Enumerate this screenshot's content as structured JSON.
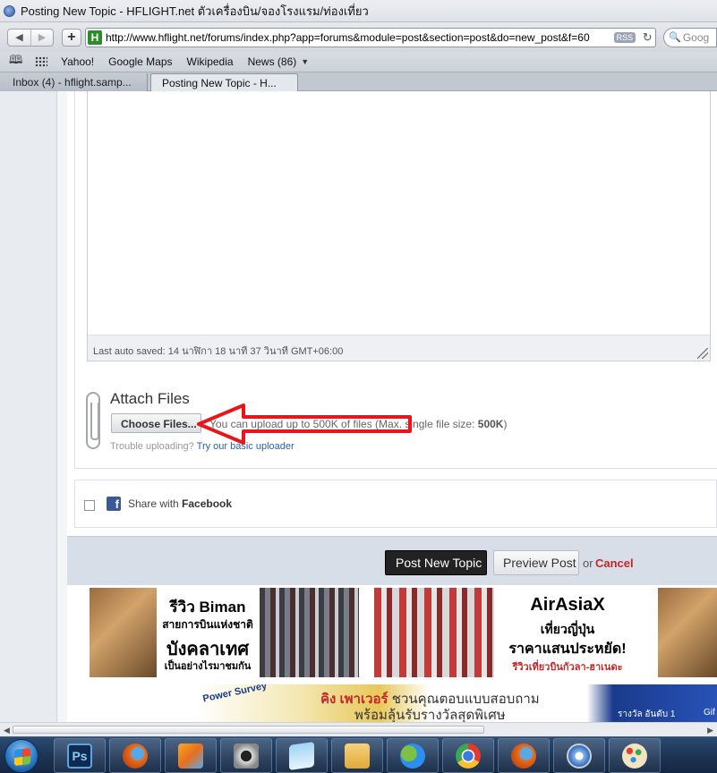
{
  "window": {
    "title": "Posting New Topic - HFLIGHT.net ตัวเครื่องบิน/จองโรงแรม/ท่องเที่ยว"
  },
  "toolbar": {
    "back_icon": "◀",
    "forward_icon": "▶",
    "add_icon": "+",
    "site_icon_letter": "H",
    "url": "http://www.hflight.net/forums/index.php?app=forums&module=post&section=post&do=new_post&f=60",
    "rss_label": "RSS",
    "reload_icon": "↻",
    "search_icon": "🔍",
    "search_placeholder": "Goog"
  },
  "bookmarks": {
    "items": [
      "Yahoo!",
      "Google Maps",
      "Wikipedia",
      "News (86)"
    ],
    "news_arrow": "▼"
  },
  "tabs": [
    {
      "label": "Inbox (4) - hflight.samp..."
    },
    {
      "label": "Posting New Topic - H..."
    }
  ],
  "editor": {
    "autosave_text": "Last auto saved: 14 นาฬิกา 18 นาที 37 วินาที GMT+06:00"
  },
  "attach": {
    "title": "Attach Files",
    "choose_button": "Choose Files...",
    "note_prefix": "You can upload up to ",
    "note_size": "500K",
    "note_middle": " of files (Max. single file size: ",
    "note_max": "500K",
    "note_suffix": ")",
    "trouble_text": "Trouble uploading?",
    "basic_uploader_link": "Try our basic uploader"
  },
  "share": {
    "label_prefix": "Share with ",
    "label_service": "Facebook",
    "fb_letter": "f"
  },
  "actions": {
    "post_button": "Post New Topic",
    "preview_button": "Preview Post",
    "or_text": "or",
    "cancel_link": "Cancel"
  },
  "ads": {
    "ad1_line1": "รีวิว  Biman",
    "ad1_line2": "สายการบินแห่งชาติ",
    "ad1_line3": "บังคลาเทศ",
    "ad1_line4": "เป็นอย่างไรมาชมกัน",
    "ad2_line1": "AirAsiaX",
    "ad2_line2": "เที่ยวญี่ปุ่น",
    "ad2_line3": "ราคาแสนประหยัด!",
    "ad2_line4": "รีวิวเที่ยวบินกัวลา-ฮาเนดะ",
    "banner_left": "Power Survey",
    "banner_mid1_brand": "คิง เพาเวอร์",
    "banner_mid1_rest": " ชวนคุณตอบแบบสอบถาม",
    "banner_mid2": "พร้อมลุ้นรับรางวัลสุดพิเศษ",
    "banner_right": "รางวัล อันดับ 1",
    "banner_gift": "Gif"
  },
  "scrollbar": {
    "left_arrow": "◀",
    "right_arrow": "▶"
  },
  "taskbar": {
    "apps": [
      "photoshop",
      "firefox",
      "paint-folder",
      "speaker",
      "notepad",
      "explorer",
      "messenger",
      "chrome",
      "firefox",
      "safari",
      "paint"
    ],
    "ps_label": "Ps"
  }
}
